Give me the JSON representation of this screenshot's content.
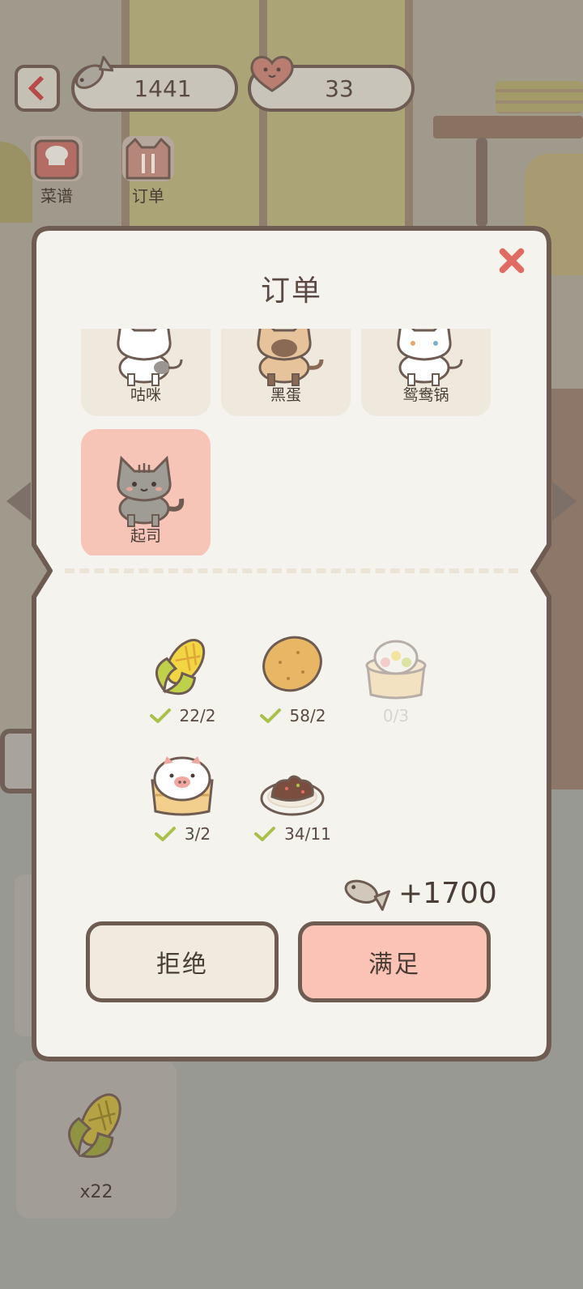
{
  "hud": {
    "fish_count": "1441",
    "heart_count": "33",
    "back_icon": "chevron-left-icon"
  },
  "tabs": [
    {
      "label": "菜谱",
      "icon": "chef-hat-book-icon"
    },
    {
      "label": "订单",
      "icon": "cat-cutlery-icon"
    }
  ],
  "modal": {
    "title": "订单",
    "close_icon": "close-icon",
    "customers": [
      {
        "name": "咕咪",
        "color": "white-gray"
      },
      {
        "name": "黑蛋",
        "color": "siamese"
      },
      {
        "name": "鸳鸯锅",
        "color": "white-heterochromia"
      },
      {
        "name": "起司",
        "color": "gray-tabby",
        "selected": true
      }
    ],
    "ingredients": [
      {
        "name": "corn",
        "count": "22/2",
        "met": true
      },
      {
        "name": "potato",
        "count": "58/2",
        "met": true
      },
      {
        "name": "dumpling-basket",
        "count": "0/3",
        "met": false
      },
      {
        "name": "pig-bun",
        "count": "3/2",
        "met": true
      },
      {
        "name": "meat-dish",
        "count": "34/11",
        "met": true
      }
    ],
    "reward": "+1700",
    "reject_label": "拒绝",
    "fulfill_label": "满足"
  },
  "inventory": {
    "item": "corn",
    "count": "x22"
  },
  "colors": {
    "accent_pink": "#fac3b5",
    "border_brown": "#6e5b52",
    "close_red": "#e06b62",
    "check_green": "#a9c04a"
  }
}
